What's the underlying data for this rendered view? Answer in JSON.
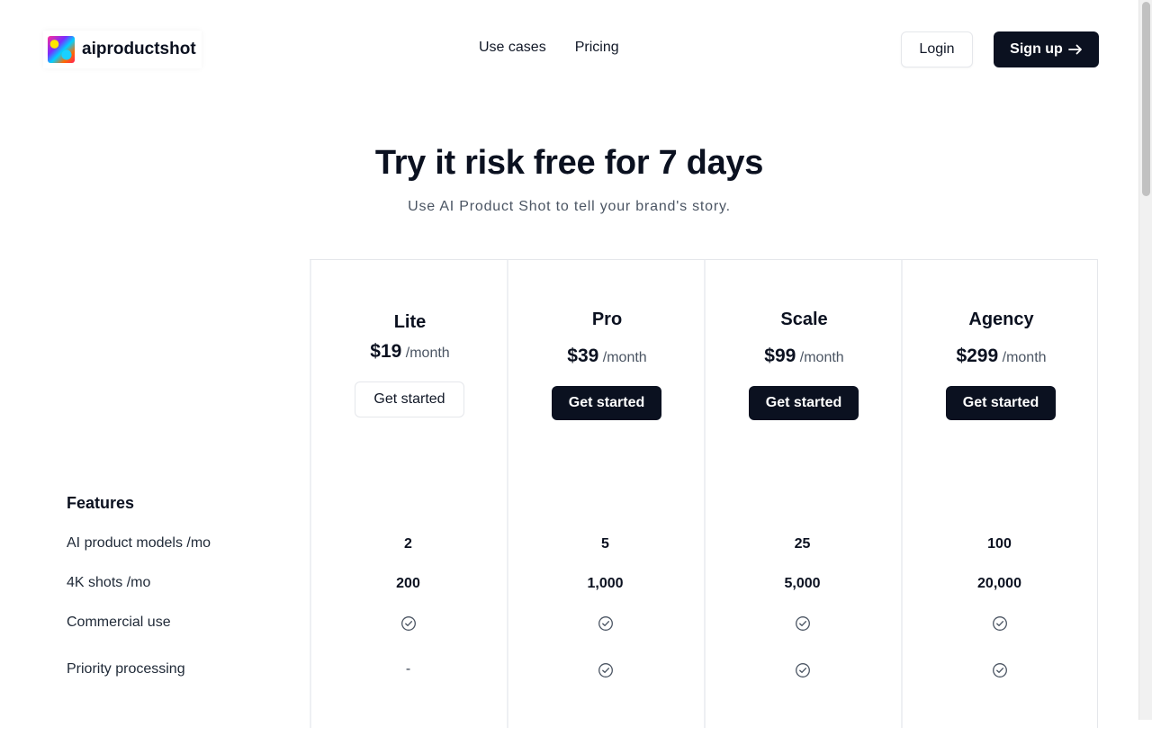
{
  "header": {
    "brand": "aiproductshot",
    "nav": [
      "Use cases",
      "Pricing"
    ],
    "login_label": "Login",
    "signup_label": "Sign up",
    "signup_icon": "arrow-right-icon"
  },
  "hero": {
    "title": "Try it risk free for 7 days",
    "subtitle": "Use AI Product Shot to tell your brand's story."
  },
  "plans": [
    {
      "name": "Lite",
      "price": "$19",
      "period": "/month",
      "cta": "Get started",
      "style": "outline"
    },
    {
      "name": "Pro",
      "price": "$39",
      "period": "/month",
      "cta": "Get started",
      "style": "solid"
    },
    {
      "name": "Scale",
      "price": "$99",
      "period": "/month",
      "cta": "Get started",
      "style": "solid"
    },
    {
      "name": "Agency",
      "price": "$299",
      "period": "/month",
      "cta": "Get started",
      "style": "solid"
    }
  ],
  "features": {
    "heading": "Features",
    "rows": [
      {
        "label": "AI product models /mo",
        "values": [
          "2",
          "5",
          "25",
          "100"
        ]
      },
      {
        "label": "4K shots /mo",
        "values": [
          "200",
          "1,000",
          "5,000",
          "20,000"
        ]
      },
      {
        "label": "Commercial use",
        "values": [
          "check",
          "check",
          "check",
          "check"
        ]
      },
      {
        "label": "Priority processing",
        "values": [
          "-",
          "check",
          "check",
          "check"
        ]
      }
    ]
  },
  "colors": {
    "primary": "#0b1120",
    "border": "#e5e7eb",
    "muted_text": "#4b5563"
  }
}
